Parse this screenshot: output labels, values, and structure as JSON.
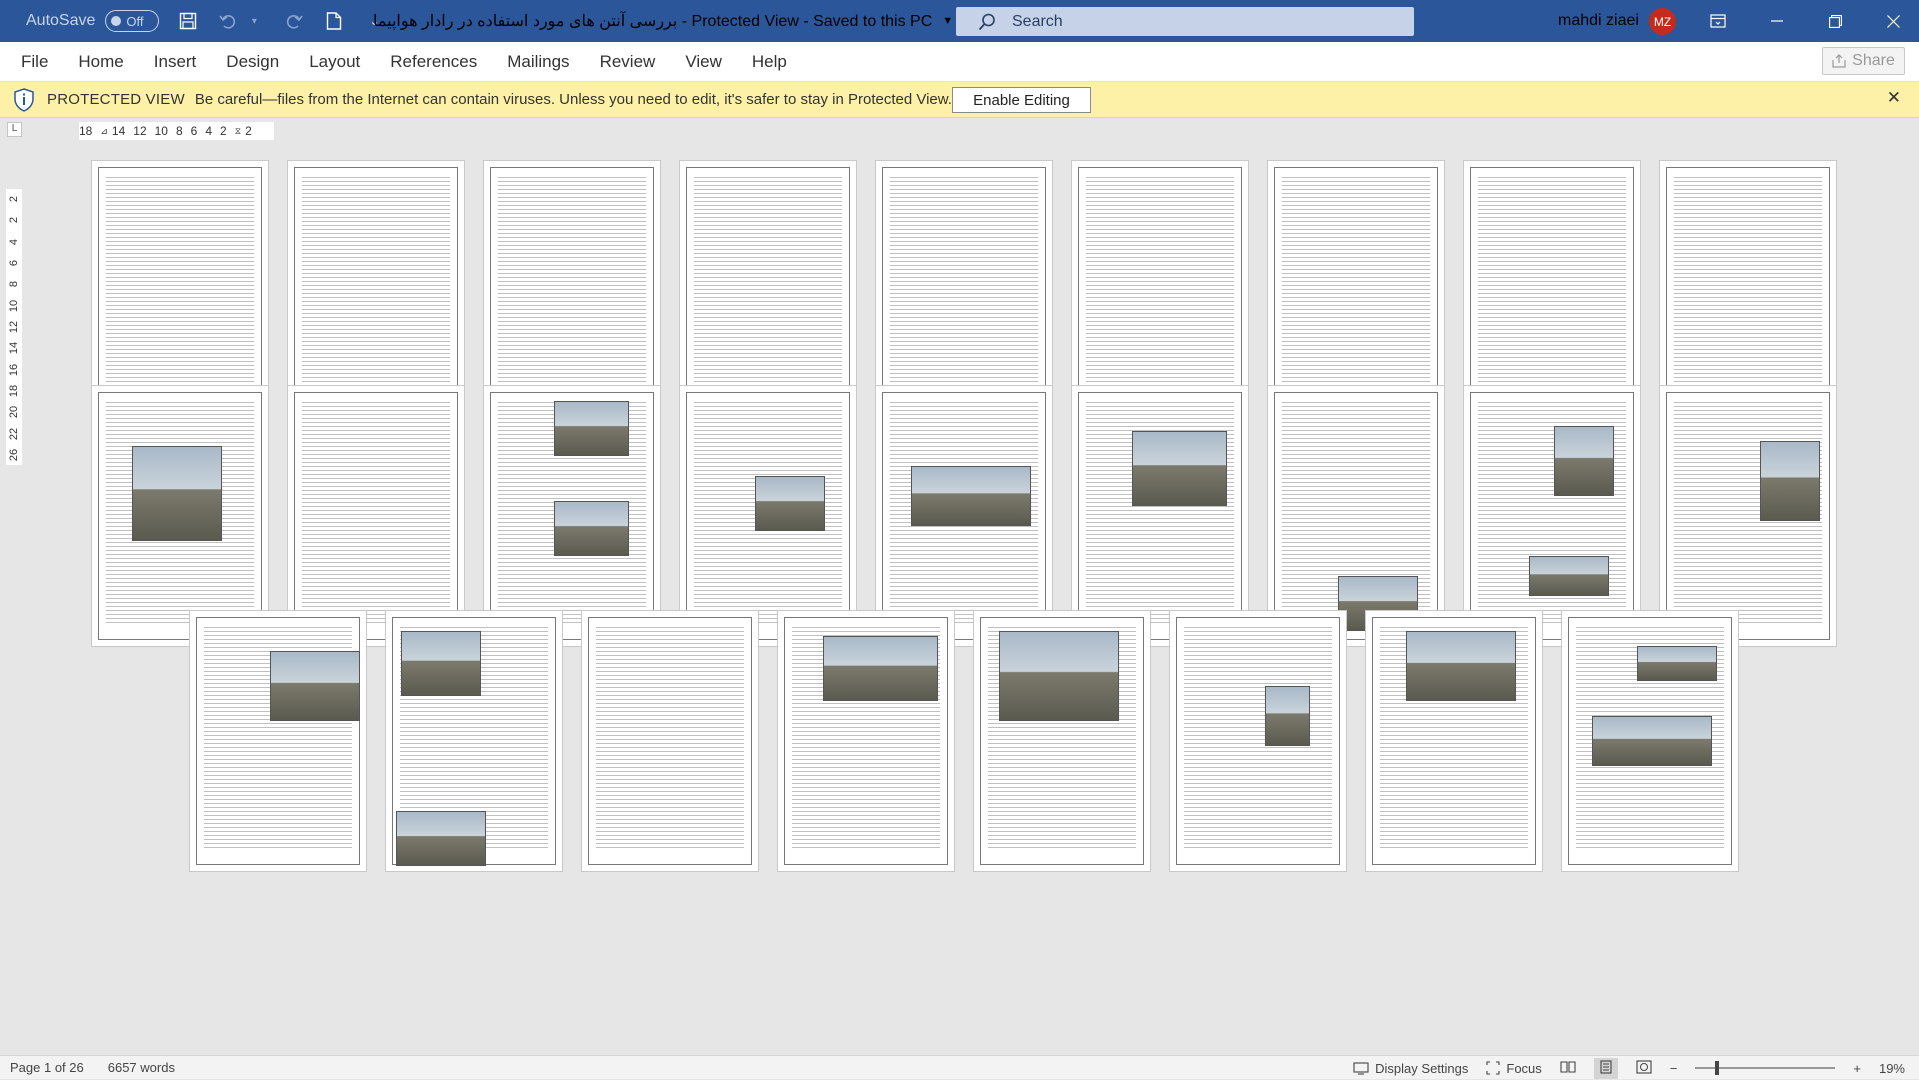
{
  "titlebar": {
    "autosave_label": "AutoSave",
    "autosave_state": "Off",
    "document_title": "بررسی آنتن های مورد استفاده در رادار هواپیما  -  Protected View  -  Saved to this PC",
    "search_placeholder": "Search",
    "user_name": "mahdi ziaei",
    "user_initials": "MZ"
  },
  "ribbon": {
    "tabs": [
      "File",
      "Home",
      "Insert",
      "Design",
      "Layout",
      "References",
      "Mailings",
      "Review",
      "View",
      "Help"
    ],
    "share_label": "Share"
  },
  "protected_view": {
    "title": "PROTECTED VIEW",
    "message": "Be careful—files from the Internet can contain viruses. Unless you need to edit, it's safer to stay in Protected View.",
    "button_label": "Enable Editing"
  },
  "ruler": {
    "corner": "L",
    "marks": [
      "18",
      "14",
      "12",
      "10",
      "8",
      "6",
      "4",
      "2",
      "2"
    ],
    "vertical_marks": [
      "2",
      "2",
      "4",
      "6",
      "8",
      "10",
      "12",
      "14",
      "16",
      "18",
      "20",
      "22",
      "26"
    ]
  },
  "document": {
    "page_count": 26
  },
  "status": {
    "page_info": "Page 1 of 26",
    "word_count": "6657 words",
    "display_settings": "Display Settings",
    "focus": "Focus",
    "zoom": "19%"
  },
  "colors": {
    "title_bar": "#2b579a",
    "avatar": "#c42b1c",
    "protected_bar": "#fdf1a8"
  }
}
